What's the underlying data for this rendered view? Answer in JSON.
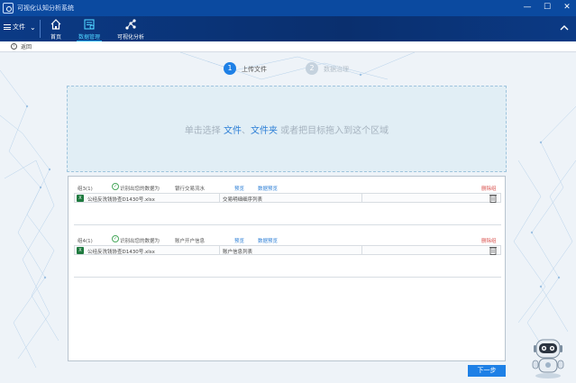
{
  "app": {
    "title": "可视化认知分析系统"
  },
  "window_controls": {
    "minimize": "—",
    "maximize": "☐",
    "close": "✕"
  },
  "toolbar": {
    "file_menu": "文件",
    "items": [
      {
        "label": "首页"
      },
      {
        "label": "数据管理"
      },
      {
        "label": "可视化分析"
      }
    ]
  },
  "nav": {
    "back_label": "返回"
  },
  "steps": [
    {
      "num": "1",
      "label": "上传文件",
      "color": "#1e80e6",
      "label_color": "#555"
    },
    {
      "num": "2",
      "label": "数据治理",
      "color": "#c5d2de",
      "label_color": "#b5c0ca"
    }
  ],
  "upload": {
    "text_before": "单击选择 ",
    "link_file": "文件",
    "comma": "、",
    "link_folder": "文件夹",
    "text_after": " 或者把目标拖入到这个区域"
  },
  "groups": [
    {
      "name": "组3(1)",
      "recognized_prefix": "识别出您的数据为",
      "data_type": "银行交易流水",
      "action_a": "预览",
      "action_b": "数据预览",
      "delete_label": "删除组",
      "file": {
        "name": "公经反洗钱协查D1430号.xlsx",
        "sheet": "交易明细细序列表"
      }
    },
    {
      "name": "组4(1)",
      "recognized_prefix": "识别出您的数据为",
      "data_type": "账户开户信息",
      "action_a": "预览",
      "action_b": "数据预览",
      "delete_label": "删除组",
      "file": {
        "name": "公经反洗钱协查D1430号.xlsx",
        "sheet": "账户信息列表"
      }
    }
  ],
  "footer": {
    "next_label": "下一步"
  },
  "colors": {
    "titlebar": "#0b4aa0",
    "accent": "#1e80e6",
    "link": "#2d7fd6",
    "delete": "#d9534f"
  }
}
